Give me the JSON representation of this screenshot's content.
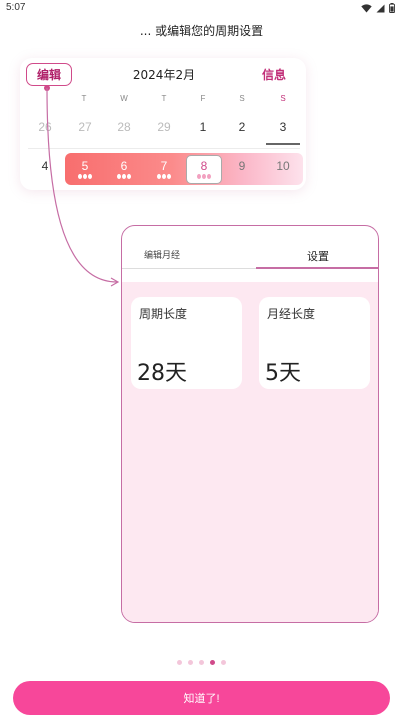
{
  "status_bar": {
    "time": "5:07"
  },
  "headline": "... 或编辑您的周期设置",
  "calendar": {
    "edit_label": "编辑",
    "month_title": "2024年2月",
    "info_label": "信息",
    "weekdays": [
      "T",
      "W",
      "T",
      "F",
      "S",
      "S"
    ],
    "row1": [
      "26",
      "27",
      "28",
      "29",
      "1",
      "2",
      "3"
    ],
    "row2": [
      "4",
      "5",
      "6",
      "7",
      "8",
      "9",
      "10"
    ]
  },
  "panel": {
    "tabs": [
      {
        "label": "编辑月经"
      },
      {
        "label": "设置"
      }
    ],
    "cycle_length": {
      "label": "周期长度",
      "value": "28天"
    },
    "period_length": {
      "label": "月经长度",
      "value": "5天"
    }
  },
  "pager": {
    "count": 5,
    "active_index": 3
  },
  "got_it_label": "知道了!",
  "colors": {
    "accent": "#f7479a",
    "brand": "#c23079",
    "period": "#f86e6e"
  }
}
